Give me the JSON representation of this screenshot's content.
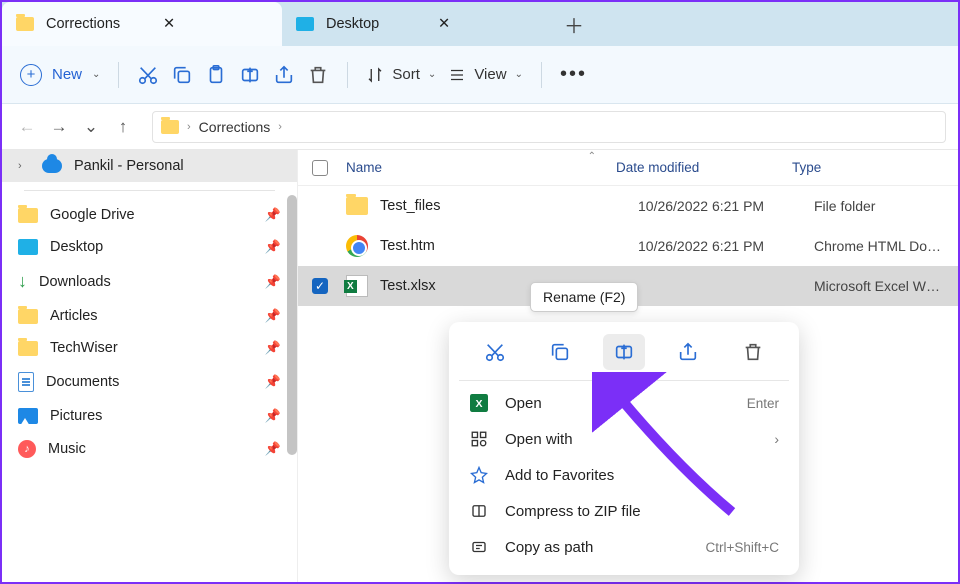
{
  "tabs": [
    {
      "label": "Corrections",
      "active": true,
      "icon": "folder"
    },
    {
      "label": "Desktop",
      "active": false,
      "icon": "desktop"
    }
  ],
  "toolbar": {
    "new_label": "New",
    "sort_label": "Sort",
    "view_label": "View"
  },
  "breadcrumb": {
    "path": "Corrections"
  },
  "sidebar": {
    "account": "Pankil - Personal",
    "items": [
      {
        "label": "Google Drive",
        "icon": "folder"
      },
      {
        "label": "Desktop",
        "icon": "desktop"
      },
      {
        "label": "Downloads",
        "icon": "download"
      },
      {
        "label": "Articles",
        "icon": "folder"
      },
      {
        "label": "TechWiser",
        "icon": "folder"
      },
      {
        "label": "Documents",
        "icon": "doc"
      },
      {
        "label": "Pictures",
        "icon": "pic"
      },
      {
        "label": "Music",
        "icon": "music"
      }
    ]
  },
  "columns": {
    "name": "Name",
    "date": "Date modified",
    "type": "Type"
  },
  "files": [
    {
      "name": "Test_files",
      "date": "10/26/2022 6:21 PM",
      "type": "File folder",
      "icon": "folder",
      "selected": false
    },
    {
      "name": "Test.htm",
      "date": "10/26/2022 6:21 PM",
      "type": "Chrome HTML Do…",
      "icon": "chrome",
      "selected": false
    },
    {
      "name": "Test.xlsx",
      "date": "",
      "type": "Microsoft Excel W…",
      "icon": "xlsx",
      "selected": true
    }
  ],
  "tooltip": "Rename (F2)",
  "context_menu": {
    "items": [
      {
        "label": "Open",
        "shortcut": "Enter",
        "icon": "excel"
      },
      {
        "label": "Open with",
        "arrow": true,
        "icon": "openwith"
      },
      {
        "label": "Add to Favorites",
        "icon": "star"
      },
      {
        "label": "Compress to ZIP file",
        "icon": "zip"
      },
      {
        "label": "Copy as path",
        "shortcut": "Ctrl+Shift+C",
        "icon": "path"
      }
    ]
  }
}
